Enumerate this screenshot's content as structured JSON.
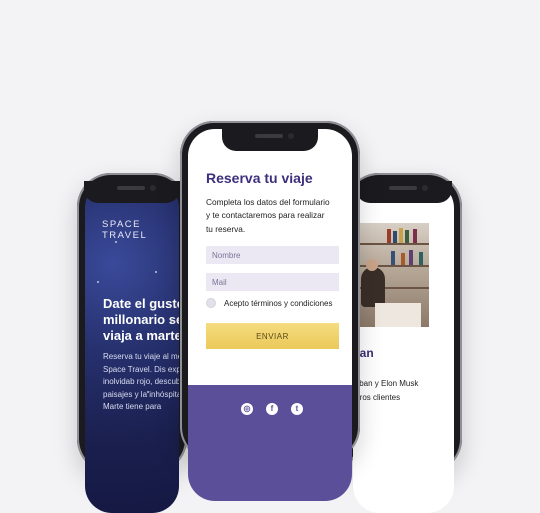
{
  "left_phone": {
    "brand": "SPACE TRAVEL",
    "headline": "Date el gusto millonario se viaja a marte",
    "body": "Reserva tu viaje al me con Space Travel. Dis experiencia inolvidab rojo, descubre los cr paisajes y la inhóspita que Marte tiene para"
  },
  "center_phone": {
    "form_title": "Reserva tu viaje",
    "form_description": "Completa los datos del formulario y te contactaremos para realizar tu reserva.",
    "name_placeholder": "Nombre",
    "mail_placeholder": "Mail",
    "terms_label": "Acepto términos y condiciones",
    "submit_label": "ENVIAR",
    "social_icons": [
      "instagram-icon",
      "facebook-icon",
      "twitter-icon"
    ]
  },
  "right_phone": {
    "title": "nfian",
    "text": "Cuban y Elon Musk estros clientes"
  },
  "colors": {
    "accent_purple": "#3d2f7d",
    "footer_purple": "#5c4f99",
    "button_yellow": "#ebc95a",
    "field_bg": "#ebe8f4"
  }
}
